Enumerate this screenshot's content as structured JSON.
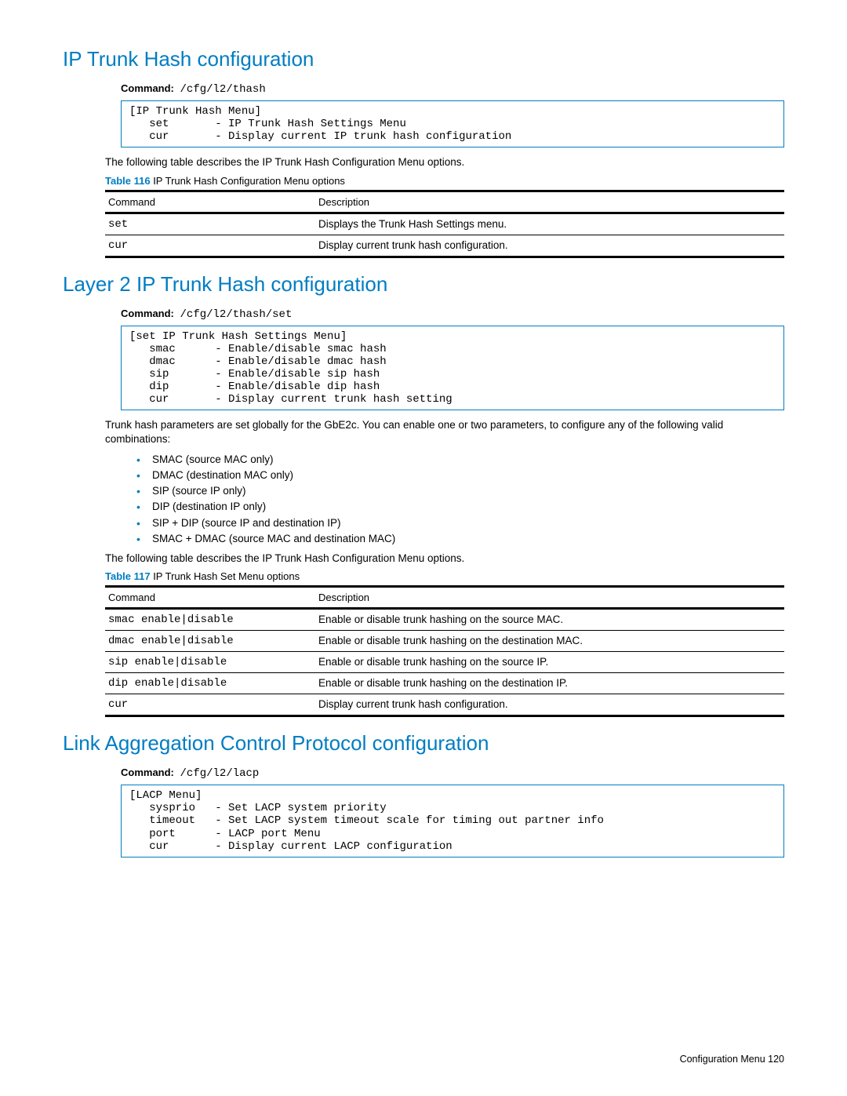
{
  "section1": {
    "heading": "IP Trunk Hash configuration",
    "command_label": "Command:",
    "command_path": "/cfg/l2/thash",
    "code": "[IP Trunk Hash Menu]\n   set       - IP Trunk Hash Settings Menu\n   cur       - Display current IP trunk hash configuration",
    "intro": "The following table describes the IP Trunk Hash Configuration Menu options.",
    "table_caption_num": "Table 116",
    "table_caption_text": "  IP Trunk Hash Configuration Menu options",
    "table": {
      "hdr_cmd": "Command",
      "hdr_desc": "Description",
      "rows": [
        {
          "cmd": "set",
          "desc": "Displays the Trunk Hash Settings menu."
        },
        {
          "cmd": "cur",
          "desc": "Display current trunk hash configuration."
        }
      ]
    }
  },
  "section2": {
    "heading": "Layer 2 IP Trunk Hash configuration",
    "command_label": "Command:",
    "command_path": "/cfg/l2/thash/set",
    "code": "[set IP Trunk Hash Settings Menu]\n   smac      - Enable/disable smac hash\n   dmac      - Enable/disable dmac hash\n   sip       - Enable/disable sip hash\n   dip       - Enable/disable dip hash\n   cur       - Display current trunk hash setting",
    "intro": "Trunk hash parameters are set globally for the GbE2c. You can enable one or two parameters, to configure any of the following valid combinations:",
    "bullets": [
      "SMAC (source MAC only)",
      "DMAC (destination MAC only)",
      "SIP (source IP only)",
      "DIP (destination IP only)",
      "SIP + DIP (source IP and destination IP)",
      "SMAC + DMAC (source MAC and destination MAC)"
    ],
    "outro": "The following table describes the IP Trunk Hash Configuration Menu options.",
    "table_caption_num": "Table 117",
    "table_caption_text": "  IP Trunk Hash Set Menu options",
    "table": {
      "hdr_cmd": "Command",
      "hdr_desc": "Description",
      "rows": [
        {
          "cmd": "smac enable|disable",
          "desc": "Enable or disable trunk hashing on the source MAC."
        },
        {
          "cmd": "dmac enable|disable",
          "desc": "Enable or disable trunk hashing on the destination MAC."
        },
        {
          "cmd": "sip enable|disable",
          "desc": "Enable or disable trunk hashing on the source IP."
        },
        {
          "cmd": "dip enable|disable",
          "desc": "Enable or disable trunk hashing on the destination IP."
        },
        {
          "cmd": "cur",
          "desc": "Display current trunk hash configuration."
        }
      ]
    }
  },
  "section3": {
    "heading": "Link Aggregation Control Protocol configuration",
    "command_label": "Command:",
    "command_path": "/cfg/l2/lacp",
    "code": "[LACP Menu]\n   sysprio   - Set LACP system priority\n   timeout   - Set LACP system timeout scale for timing out partner info\n   port      - LACP port Menu\n   cur       - Display current LACP configuration"
  },
  "footer": {
    "text": "Configuration Menu   120"
  }
}
